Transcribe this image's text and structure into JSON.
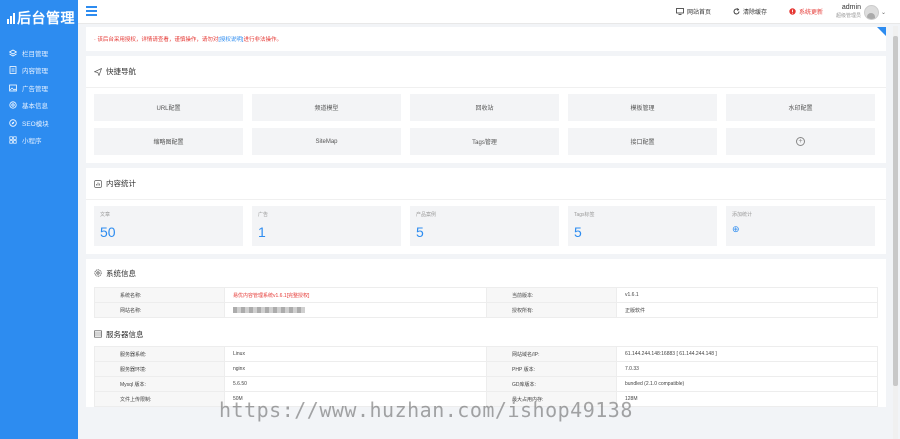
{
  "sidebar": {
    "logo": "后台管理",
    "items": [
      {
        "label": "栏目管理",
        "icon": "layers-icon"
      },
      {
        "label": "内容管理",
        "icon": "document-icon"
      },
      {
        "label": "广告管理",
        "icon": "image-icon"
      },
      {
        "label": "基本信息",
        "icon": "settings-icon"
      },
      {
        "label": "SEO模块",
        "icon": "compass-icon"
      },
      {
        "label": "小程序",
        "icon": "grid-icon"
      }
    ]
  },
  "topbar": {
    "site_home": "网站首页",
    "clear_cache": "清除缓存",
    "system_update": "系统更新",
    "user_name": "admin",
    "user_role": "超级管理员"
  },
  "notice": {
    "text_before": "· 该后台采用授权，详情请查看，谨慎操作，请勿对",
    "link": "[授权说明]",
    "text_after": "进行非法操作。"
  },
  "quick_nav": {
    "title": "快捷导航",
    "items": [
      "URL配置",
      "频道模型",
      "回收站",
      "模板管理",
      "水印配置",
      "缩略图配置",
      "SiteMap",
      "Tags管理",
      "接口配置",
      "+"
    ]
  },
  "content_stats": {
    "title": "内容统计",
    "items": [
      {
        "label": "文章",
        "value": "50"
      },
      {
        "label": "广告",
        "value": "1"
      },
      {
        "label": "产品案例",
        "value": "5"
      },
      {
        "label": "Tags标签",
        "value": "5"
      },
      {
        "label": "添加统计",
        "value": "⊕"
      }
    ]
  },
  "system_info": {
    "title": "系统信息",
    "rows": [
      [
        "系统名称:",
        "易优内容管理系统v1.6.1[完整授权]",
        "当前版本:",
        "v1.6.1"
      ],
      [
        "网站名称:",
        "",
        "授权所有:",
        "正版软件"
      ]
    ]
  },
  "server_info": {
    "title": "服务器信息",
    "rows": [
      [
        "服务器系统:",
        "Linux",
        "网站域名/IP:",
        "61.144.244.148:16883 [ 61.144.244.148 ]"
      ],
      [
        "服务器环境:",
        "nginx",
        "PHP 版本:",
        "7.0.33"
      ],
      [
        "Mysql 版本:",
        "5.6.50",
        "GD库版本:",
        "bundled (2.1.0 compatible)"
      ],
      [
        "文件上传限制:",
        "50M",
        "最大占用内存:",
        "128M"
      ]
    ]
  },
  "watermark": "https://www.huzhan.com/ishop49138",
  "colors": {
    "accent": "#2d8cf0",
    "danger": "#e53935",
    "panel": "#f3f4f6"
  }
}
